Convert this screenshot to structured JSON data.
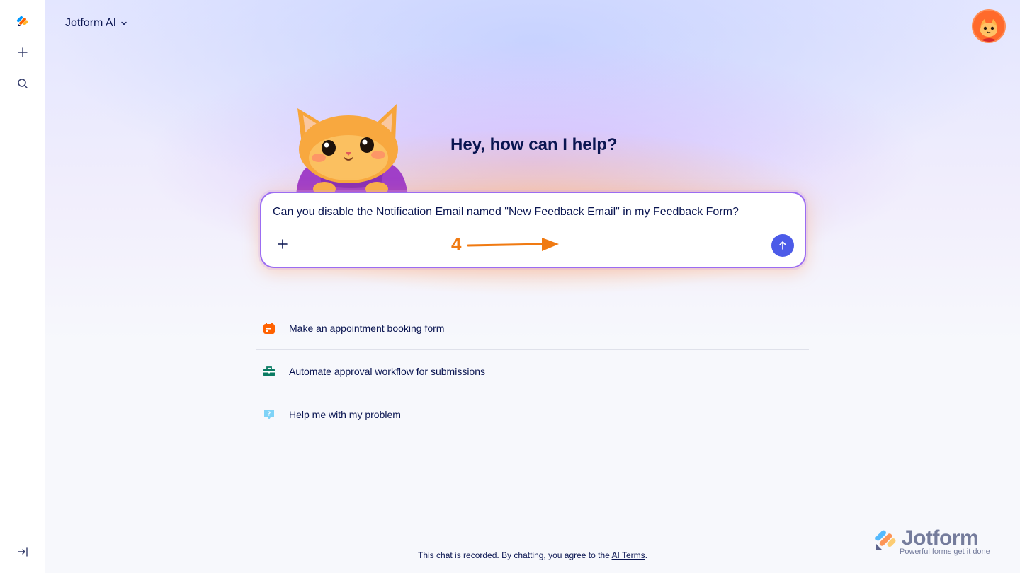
{
  "header": {
    "title": "Jotform AI"
  },
  "greeting": "Hey, how can I help?",
  "prompt": {
    "value": "Can you disable the Notification Email named \"New Feedback Email\" in my Feedback Form?"
  },
  "annotation": {
    "step": "4"
  },
  "suggestions": [
    {
      "label": "Make an appointment booking form",
      "icon": "calendar-icon",
      "color": "#ff6100"
    },
    {
      "label": "Automate approval workflow for submissions",
      "icon": "briefcase-icon",
      "color": "#0a7b62"
    },
    {
      "label": "Help me with my problem",
      "icon": "help-bubble-icon",
      "color": "#7fd3f7"
    }
  ],
  "footer": {
    "text": "This chat is recorded. By chatting, you agree to the ",
    "link": "AI Terms",
    "end": "."
  },
  "brand": {
    "name": "Jotform",
    "tagline": "Powerful forms get it done"
  },
  "colors": {
    "accent": "#4c5be8",
    "border": "#9b6cf2",
    "annotation": "#f07a12",
    "text": "#0a1551"
  }
}
